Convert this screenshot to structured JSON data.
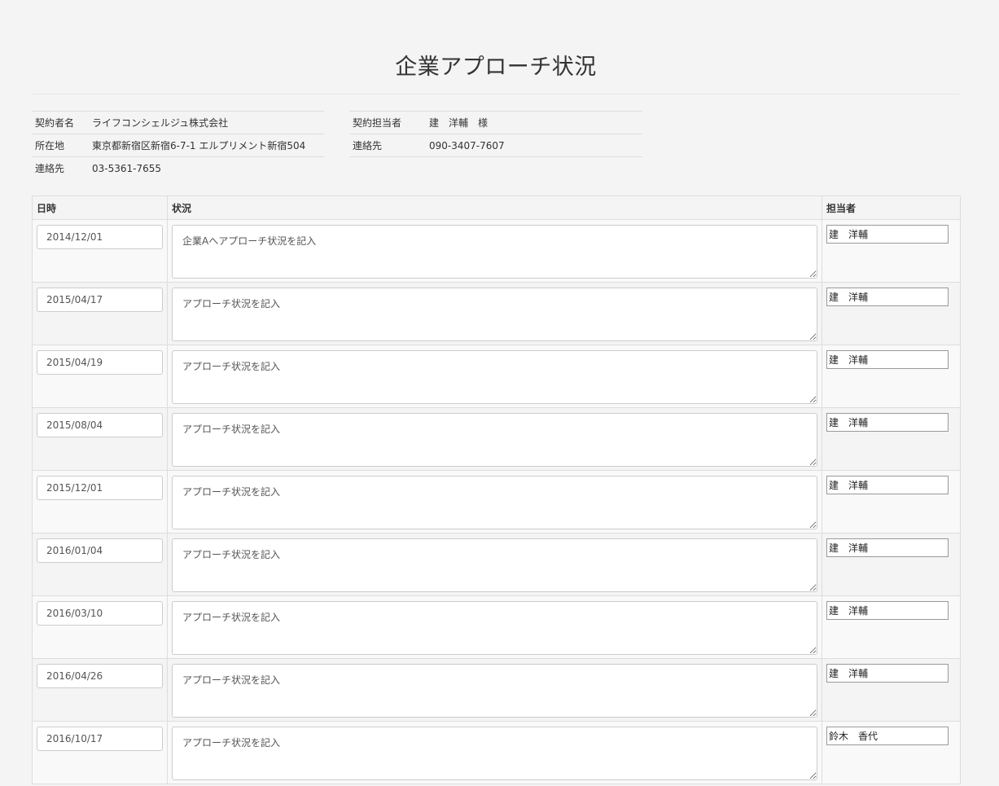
{
  "page_title": "企業アプローチ状況",
  "contract_left": [
    {
      "label": "契約者名",
      "value": "ライフコンシェルジュ株式会社"
    },
    {
      "label": "所在地",
      "value": "東京都新宿区新宿6-7-1 エルプリメント新宿504"
    },
    {
      "label": "連絡先",
      "value": "03-5361-7655"
    }
  ],
  "contract_right": [
    {
      "label": "契約担当者",
      "value": "建　洋輔　様"
    },
    {
      "label": "連絡先",
      "value": "090-3407-7607"
    }
  ],
  "table": {
    "headers": {
      "date": "日時",
      "status": "状況",
      "person": "担当者"
    },
    "rows": [
      {
        "date": "2014/12/01",
        "status": "企業Aへアプローチ状況を記入",
        "person": "建　洋輔"
      },
      {
        "date": "2015/04/17",
        "status": "アプローチ状況を記入",
        "person": "建　洋輔"
      },
      {
        "date": "2015/04/19",
        "status": "アプローチ状況を記入",
        "person": "建　洋輔"
      },
      {
        "date": "2015/08/04",
        "status": "アプローチ状況を記入",
        "person": "建　洋輔"
      },
      {
        "date": "2015/12/01",
        "status": "アプローチ状況を記入",
        "person": "建　洋輔"
      },
      {
        "date": "2016/01/04",
        "status": "アプローチ状況を記入",
        "person": "建　洋輔"
      },
      {
        "date": "2016/03/10",
        "status": "アプローチ状況を記入",
        "person": "建　洋輔"
      },
      {
        "date": "2016/04/26",
        "status": "アプローチ状況を記入",
        "person": "建　洋輔"
      },
      {
        "date": "2016/10/17",
        "status": "アプローチ状況を記入",
        "person": "鈴木　香代"
      }
    ]
  }
}
